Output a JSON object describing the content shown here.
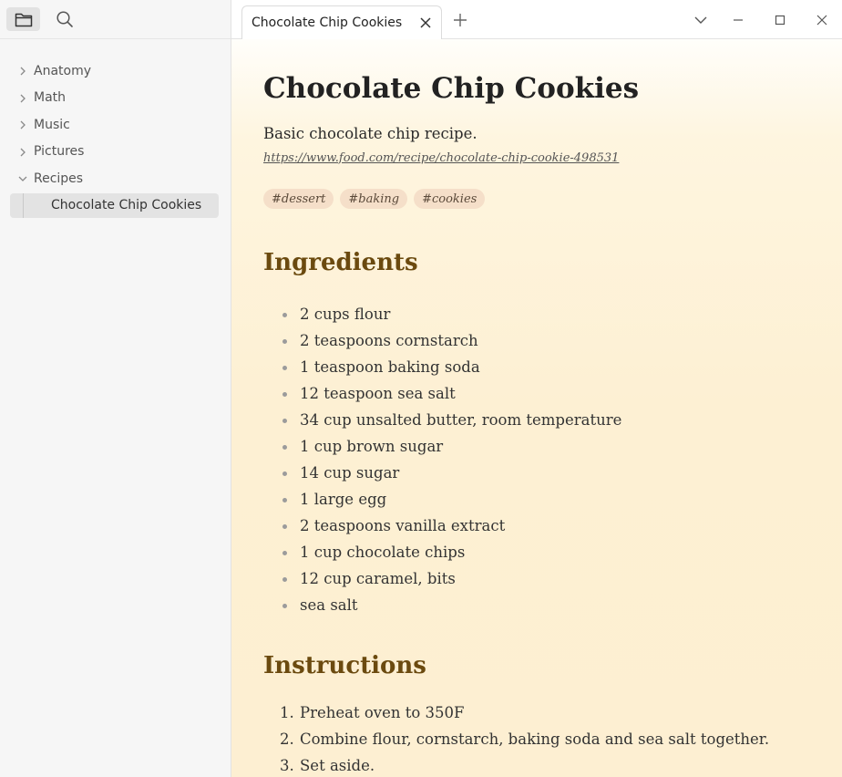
{
  "sidebar": {
    "items": [
      {
        "label": "Anatomy"
      },
      {
        "label": "Math"
      },
      {
        "label": "Music"
      },
      {
        "label": "Pictures"
      },
      {
        "label": "Recipes",
        "expanded": true
      }
    ],
    "selected_child": "Chocolate Chip Cookies"
  },
  "tabs": {
    "active_label": "Chocolate Chip Cookies"
  },
  "note": {
    "title": "Chocolate Chip Cookies",
    "description": "Basic chocolate chip recipe.",
    "link": "https://www.food.com/recipe/chocolate-chip-cookie-498531",
    "tags": [
      "#dessert",
      "#baking",
      "#cookies"
    ],
    "ingredients_heading": "Ingredients",
    "ingredients": [
      "2 cups flour",
      "2 teaspoons cornstarch",
      "1 teaspoon baking soda",
      "12 teaspoon sea salt",
      "34 cup unsalted butter, room temperature",
      "1 cup brown sugar",
      "14 cup sugar",
      "1 large egg",
      "2 teaspoons vanilla extract",
      "1 cup chocolate chips",
      "12 cup caramel, bits",
      "sea salt"
    ],
    "instructions_heading": "Instructions",
    "instructions": [
      {
        "num": "1.",
        "text": "Preheat oven to 350F"
      },
      {
        "num": "2.",
        "text": "Combine flour, cornstarch, baking soda and sea salt together."
      },
      {
        "num": "3.",
        "text": "Set aside."
      }
    ]
  },
  "colors": {
    "heading": "#6b4a0f",
    "tag_bg": "#f5dfc9",
    "content_bg": "#fdf0d3",
    "sidebar_bg": "#f6f6f6"
  },
  "icons": {
    "files": "folder-icon",
    "search": "search-icon",
    "tab_close": "close-icon",
    "new_tab": "plus-icon",
    "tab_list": "chevron-down-icon",
    "minimize": "minimize-icon",
    "maximize": "maximize-icon",
    "close_window": "close-window-icon"
  }
}
